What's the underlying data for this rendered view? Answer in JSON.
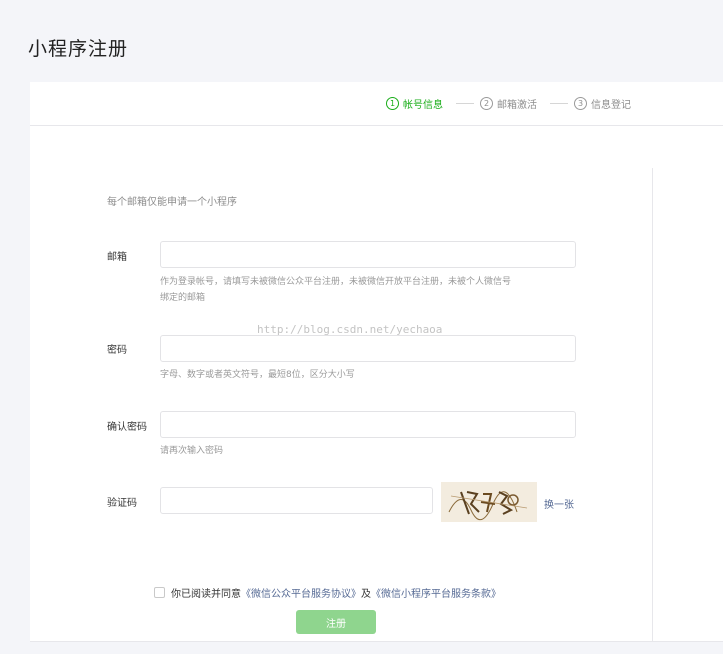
{
  "page_title": "小程序注册",
  "steps": [
    {
      "num": "1",
      "label": "帐号信息",
      "active": true
    },
    {
      "num": "2",
      "label": "邮箱激活",
      "active": false
    },
    {
      "num": "3",
      "label": "信息登记",
      "active": false
    }
  ],
  "tip": "每个邮箱仅能申请一个小程序",
  "form": {
    "email": {
      "label": "邮箱",
      "value": "",
      "hint_line1": "作为登录帐号，请填写未被微信公众平台注册，未被微信开放平台注册，未被个人微信号",
      "hint_line2": "绑定的邮箱"
    },
    "password": {
      "label": "密码",
      "value": "",
      "hint": "字母、数字或者英文符号，最短8位，区分大小写"
    },
    "confirm_password": {
      "label": "确认密码",
      "value": "",
      "hint": "请再次输入密码"
    },
    "captcha": {
      "label": "验证码",
      "value": "",
      "refresh_label": "换一张"
    }
  },
  "agreement": {
    "prefix": "你已阅读并同意",
    "link1": "《微信公众平台服务协议》",
    "middle": "及",
    "link2": "《微信小程序平台服务条款》",
    "checked": false
  },
  "submit_label": "注册",
  "watermark": "http://blog.csdn.net/yechaoa",
  "colors": {
    "accent": "#1aad19",
    "link": "#576b95",
    "button_disabled": "#8fd58e"
  }
}
